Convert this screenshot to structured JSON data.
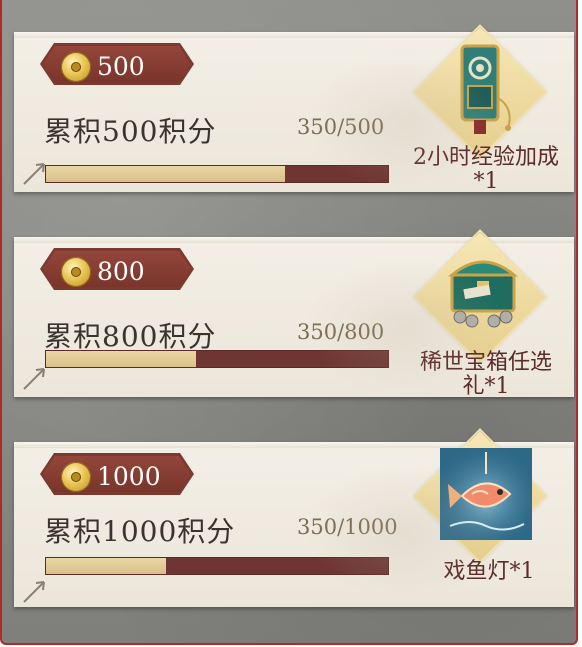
{
  "milestones": [
    {
      "badge_value": "500",
      "title": "累积500积分",
      "progress_text": "350/500",
      "progress_fraction": 0.7,
      "reward_line1": "2小时经验加成",
      "reward_line2": "*1",
      "reward_icon": "token-icon"
    },
    {
      "badge_value": "800",
      "title": "累积800积分",
      "progress_text": "350/800",
      "progress_fraction": 0.4375,
      "reward_line1": "稀世宝箱任选",
      "reward_line2": "礼*1",
      "reward_icon": "treasure-chest-icon"
    },
    {
      "badge_value": "1000",
      "title": "累积1000积分",
      "progress_text": "350/1000",
      "progress_fraction": 0.35,
      "reward_line1": "戏鱼灯*1",
      "reward_line2": "",
      "reward_icon": "fish-lantern-icon"
    }
  ],
  "colors": {
    "badge": "#7a3a30",
    "bar_track": "#6e3532",
    "bar_fill": "#ead7a6",
    "reward_text": "#5b2c2a",
    "frame_border": "#b02a2a"
  }
}
